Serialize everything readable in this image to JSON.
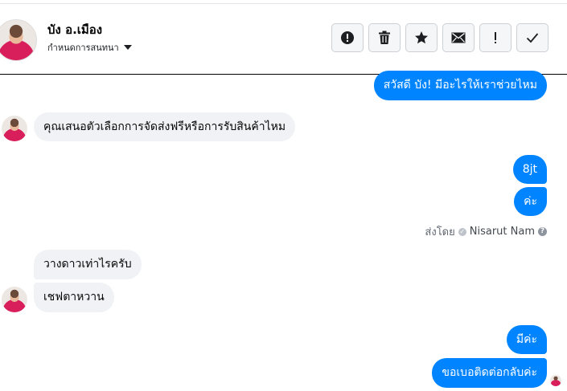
{
  "header": {
    "contact_name": "บัง อ.เมือง",
    "assign_label": "กำหนดการสนทนา",
    "actions": [
      {
        "name": "spam-button",
        "icon": "alert-circle-icon"
      },
      {
        "name": "delete-button",
        "icon": "trash-icon"
      },
      {
        "name": "star-button",
        "icon": "star-icon"
      },
      {
        "name": "mark-unread-button",
        "icon": "envelope-icon"
      },
      {
        "name": "follow-up-button",
        "icon": "exclamation-icon"
      },
      {
        "name": "mark-done-button",
        "icon": "checkmark-icon"
      }
    ]
  },
  "messages": [
    {
      "from": "page",
      "text": "สวัสดี บัง! มีอะไรให้เราช่วยไหม"
    },
    {
      "from": "user",
      "text": "คุณเสนอตัวเลือกการจัดส่งฟรีหรือการรับสินค้าไหม"
    },
    {
      "from": "page",
      "text": "8jt"
    },
    {
      "from": "page",
      "text": "ค่ะ"
    },
    {
      "from": "user",
      "text": "วางดาวเท่าไรครับ"
    },
    {
      "from": "user",
      "text": "เชฟตาหวาน"
    },
    {
      "from": "page",
      "text": "มีค่ะ"
    },
    {
      "from": "page",
      "text": "ขอเบอติดต่อกลับค่ะ"
    }
  ],
  "sent_by": {
    "label": "ส่งโดย",
    "agent": "Nisarut Nam"
  },
  "colors": {
    "outgoing_bubble": "#0084ff",
    "incoming_bubble": "#f0f2f5"
  }
}
